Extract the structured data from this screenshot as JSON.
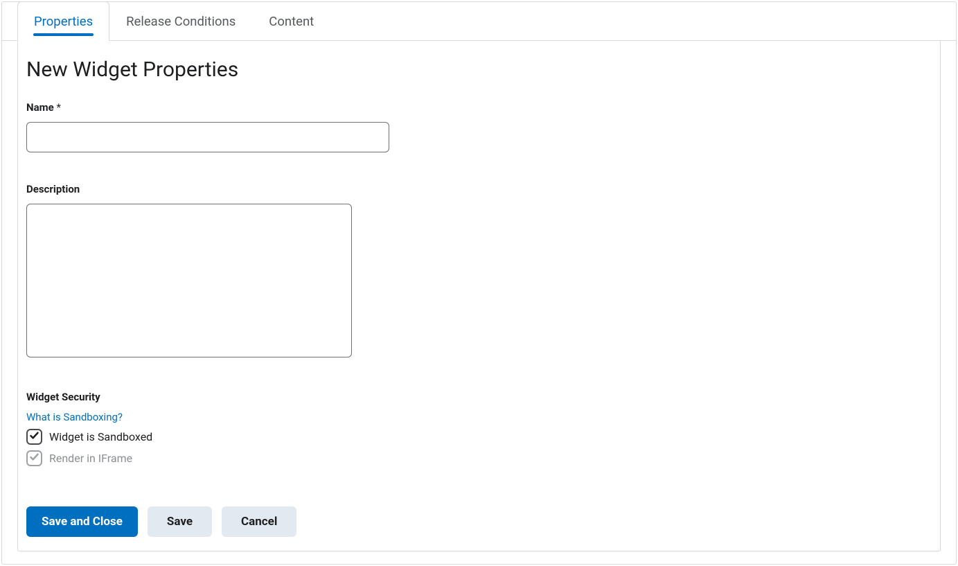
{
  "tabs": {
    "properties": "Properties",
    "release_conditions": "Release Conditions",
    "content": "Content"
  },
  "page_title": "New Widget Properties",
  "fields": {
    "name_label": "Name",
    "name_required_marker": "*",
    "name_value": "",
    "description_label": "Description",
    "description_value": ""
  },
  "security": {
    "title": "Widget Security",
    "help_link": "What is Sandboxing?",
    "sandboxed_label": "Widget is Sandboxed",
    "iframe_label": "Render in IFrame"
  },
  "buttons": {
    "save_close": "Save and Close",
    "save": "Save",
    "cancel": "Cancel"
  }
}
